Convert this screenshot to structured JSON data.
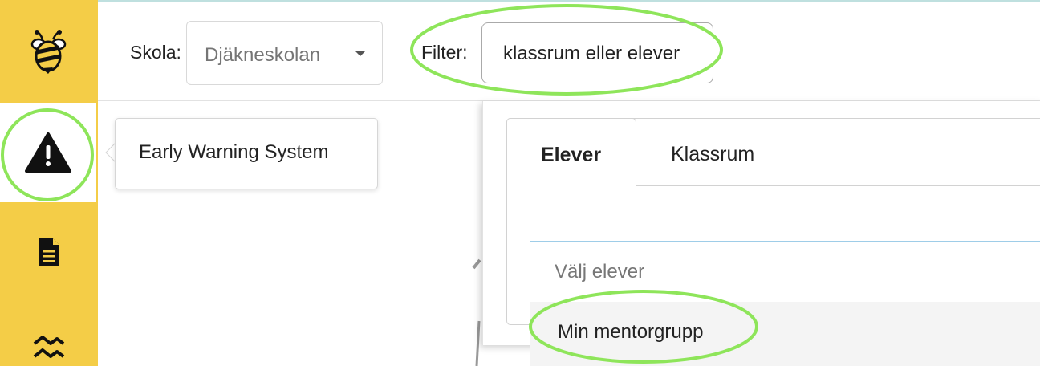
{
  "sidebar": {
    "items": [
      {
        "name": "bee-logo",
        "icon": "bee-icon"
      },
      {
        "name": "early-warning",
        "icon": "warning-triangle-icon"
      },
      {
        "name": "documents",
        "icon": "document-icon"
      },
      {
        "name": "trends",
        "icon": "trend-lines-icon"
      }
    ],
    "accent_color": "#f4cd47"
  },
  "topbar": {
    "skola_label": "Skola:",
    "skola_selected": "Djäkneskolan",
    "filter_label": "Filter:",
    "filter_value": "klassrum eller elever"
  },
  "tooltip": {
    "text": "Early Warning System"
  },
  "panel": {
    "tabs": [
      {
        "label": "Elever",
        "active": true
      },
      {
        "label": "Klassrum",
        "active": false
      }
    ],
    "student_select": {
      "placeholder": "Välj elever",
      "options": [
        "Min mentorgrupp"
      ]
    }
  },
  "highlight_color": "#8ee55a"
}
